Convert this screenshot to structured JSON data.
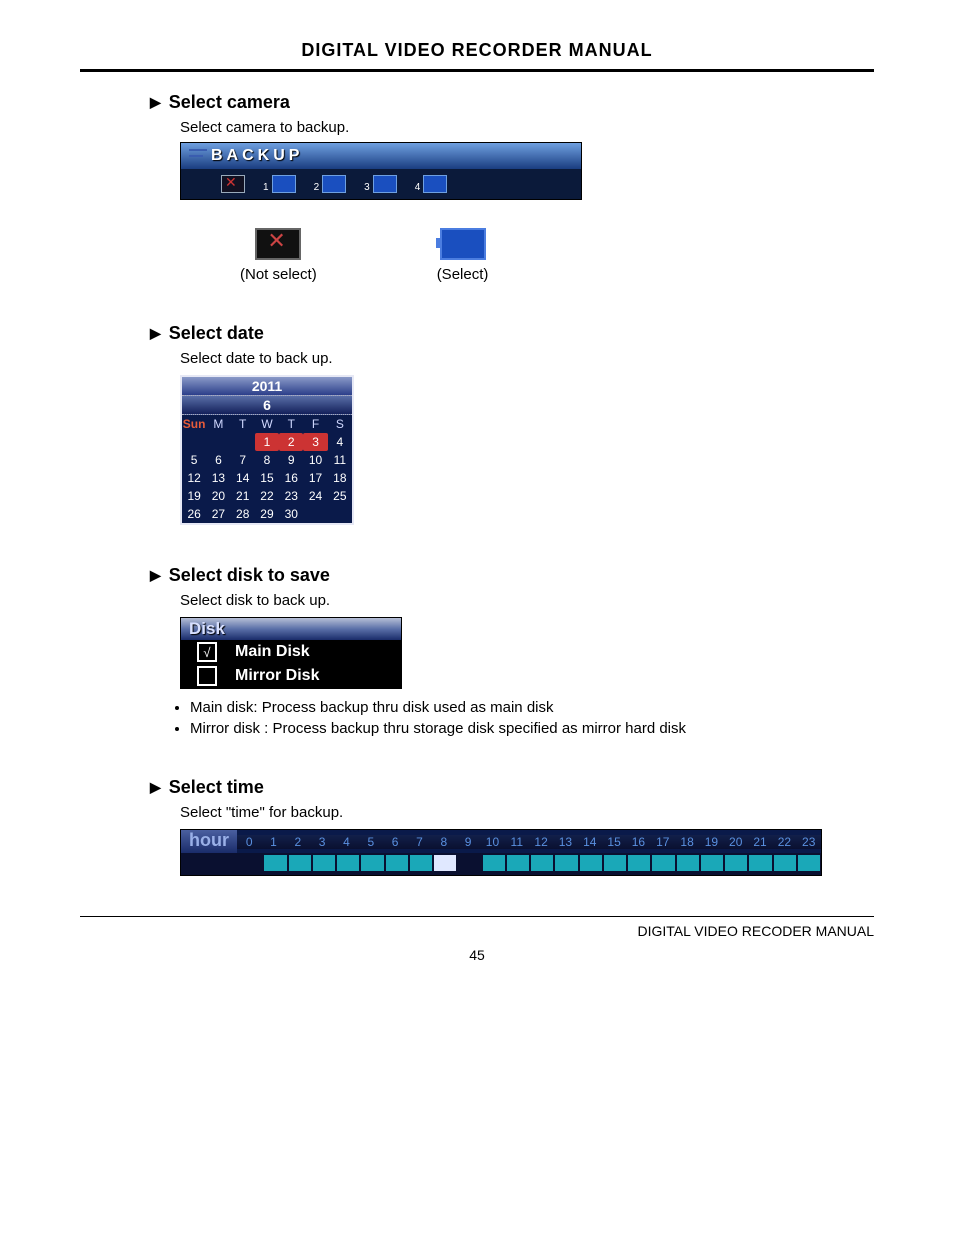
{
  "page": {
    "title": "DIGITAL VIDEO RECORDER MANUAL",
    "footer": "DIGITAL VIDEO RECODER MANUAL",
    "number": "45"
  },
  "sections": {
    "camera": {
      "heading": "Select camera",
      "text": "Select camera to backup.",
      "bar_title": "BACKUP",
      "slots": [
        "1",
        "2",
        "3",
        "4"
      ],
      "legend_notselect": "(Not select)",
      "legend_select": "(Select)"
    },
    "date": {
      "heading": "Select date",
      "text": "Select date to back up.",
      "year": "2011",
      "month": "6",
      "dow": [
        "Sun",
        "M",
        "T",
        "W",
        "T",
        "F",
        "S"
      ],
      "rows": [
        [
          "",
          "",
          "",
          "1",
          "2",
          "3",
          "4"
        ],
        [
          "5",
          "6",
          "7",
          "8",
          "9",
          "10",
          "11"
        ],
        [
          "12",
          "13",
          "14",
          "15",
          "16",
          "17",
          "18"
        ],
        [
          "19",
          "20",
          "21",
          "22",
          "23",
          "24",
          "25"
        ],
        [
          "26",
          "27",
          "28",
          "29",
          "30",
          "",
          ""
        ]
      ],
      "highlighted": [
        "1",
        "2",
        "3"
      ]
    },
    "disk": {
      "heading": "Select disk to save",
      "text": "Select disk to back up.",
      "panel_title": "Disk",
      "items": [
        {
          "checked": true,
          "label": "Main Disk"
        },
        {
          "checked": false,
          "label": "Mirror Disk"
        }
      ],
      "bullets": [
        "Main disk:   Process backup thru disk used as main disk",
        "Mirror disk : Process backup thru storage disk specified as mirror hard disk"
      ]
    },
    "time": {
      "heading": "Select time",
      "text": "Select \"time\" for backup.",
      "label": "hour",
      "hours": [
        "0",
        "1",
        "2",
        "3",
        "4",
        "5",
        "6",
        "7",
        "8",
        "9",
        "10",
        "11",
        "12",
        "13",
        "14",
        "15",
        "16",
        "17",
        "18",
        "19",
        "20",
        "21",
        "22",
        "23"
      ],
      "cells": [
        "",
        "on",
        "on",
        "on",
        "on",
        "on",
        "on",
        "on",
        "sel",
        "",
        "on",
        "on",
        "on",
        "on",
        "on",
        "on",
        "on",
        "on",
        "on",
        "on",
        "on",
        "on",
        "on",
        "on"
      ]
    }
  }
}
